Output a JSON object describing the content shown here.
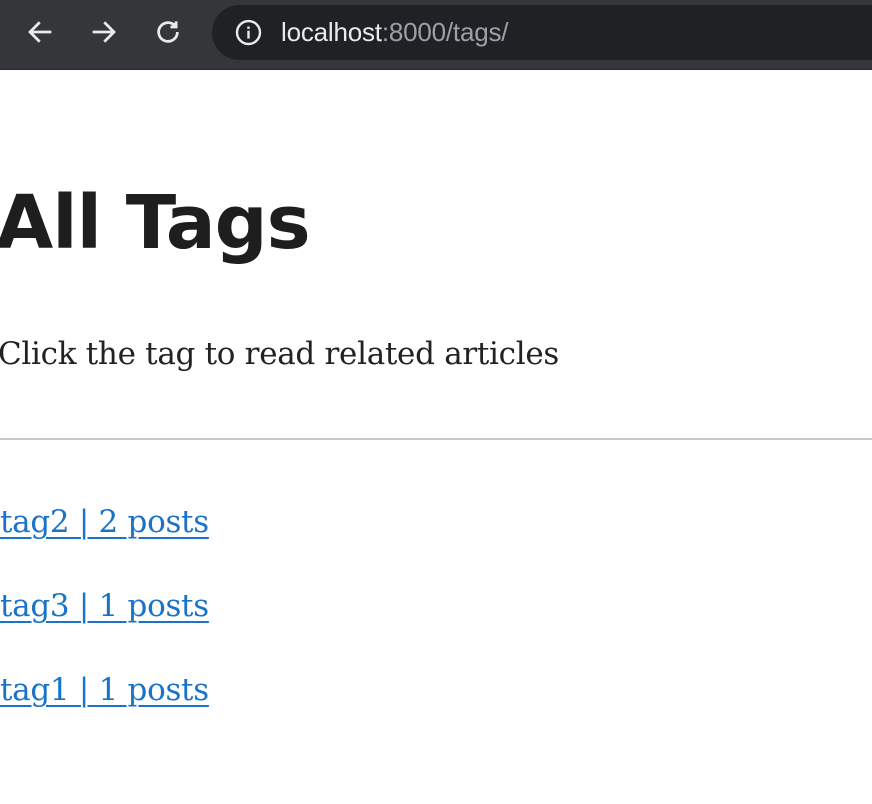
{
  "browser": {
    "url_host": "localhost",
    "url_rest": ":8000/tags/",
    "icons": {
      "back": "arrow-left",
      "forward": "arrow-right",
      "reload": "reload",
      "site_info": "info-circle"
    }
  },
  "page": {
    "title": "All Tags",
    "subtitle": "Click the tag to read related articles"
  },
  "tags": [
    {
      "label": "tag2 | 2 posts"
    },
    {
      "label": "tag3 | 1 posts"
    },
    {
      "label": "tag1 | 1 posts"
    }
  ],
  "colors": {
    "toolbar_bg": "#35363a",
    "omnibox_bg": "#202124",
    "link": "#1a73c8",
    "title": "#1e1e1e",
    "divider": "#c8c8c8"
  }
}
